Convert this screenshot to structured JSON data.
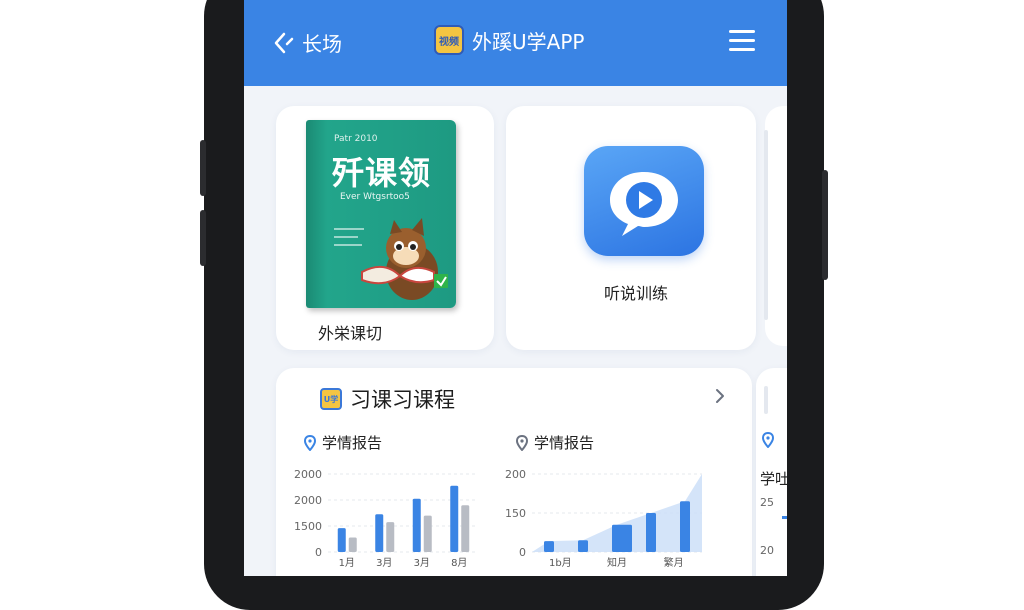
{
  "header": {
    "back_label": "长场",
    "app_title": "外蹊U学APP",
    "badge_text": "视频"
  },
  "tiles": {
    "book": {
      "small_text": "Patr 2010",
      "cover_title": "歼课领",
      "cover_subtitle": "Ever Wtgsrtoo5",
      "caption": "外栄课切"
    },
    "video": {
      "caption": "听说训练"
    }
  },
  "section": {
    "title": "习课习课程",
    "badge_text": "U学"
  },
  "reports": [
    {
      "label": "学情报告"
    },
    {
      "label": "学情报告"
    },
    {
      "label": "学吐"
    }
  ],
  "chart_data": [
    {
      "type": "bar",
      "title": "学情报告",
      "categories": [
        "1月",
        "3月",
        "3月",
        "8月"
      ],
      "y_ticks": [
        "2000",
        "2000",
        "1500",
        "0"
      ],
      "series": [
        {
          "values": [
            920,
            1450,
            2050,
            2550
          ]
        },
        {
          "values": [
            560,
            1150,
            1400,
            1800
          ]
        }
      ],
      "ylim": [
        0,
        3000
      ],
      "colors": [
        "#3a84e4",
        "#b8bcc4"
      ]
    },
    {
      "type": "bar",
      "title": "学情报告",
      "categories": [
        "1b月",
        "知月",
        "繁月"
      ],
      "y_ticks": [
        "200",
        "150",
        "0"
      ],
      "series": [
        {
          "values": [
            28,
            30,
            70,
            100,
            130
          ]
        }
      ],
      "ylim": [
        0,
        200
      ],
      "colors": [
        "#3a84e4"
      ]
    }
  ],
  "partial_chart": {
    "ticks": [
      "25",
      "20"
    ]
  },
  "colors": {
    "header_blue": "#3a84e4",
    "accent_blue": "#3a84e4",
    "bar_gray": "#b8bcc4"
  }
}
